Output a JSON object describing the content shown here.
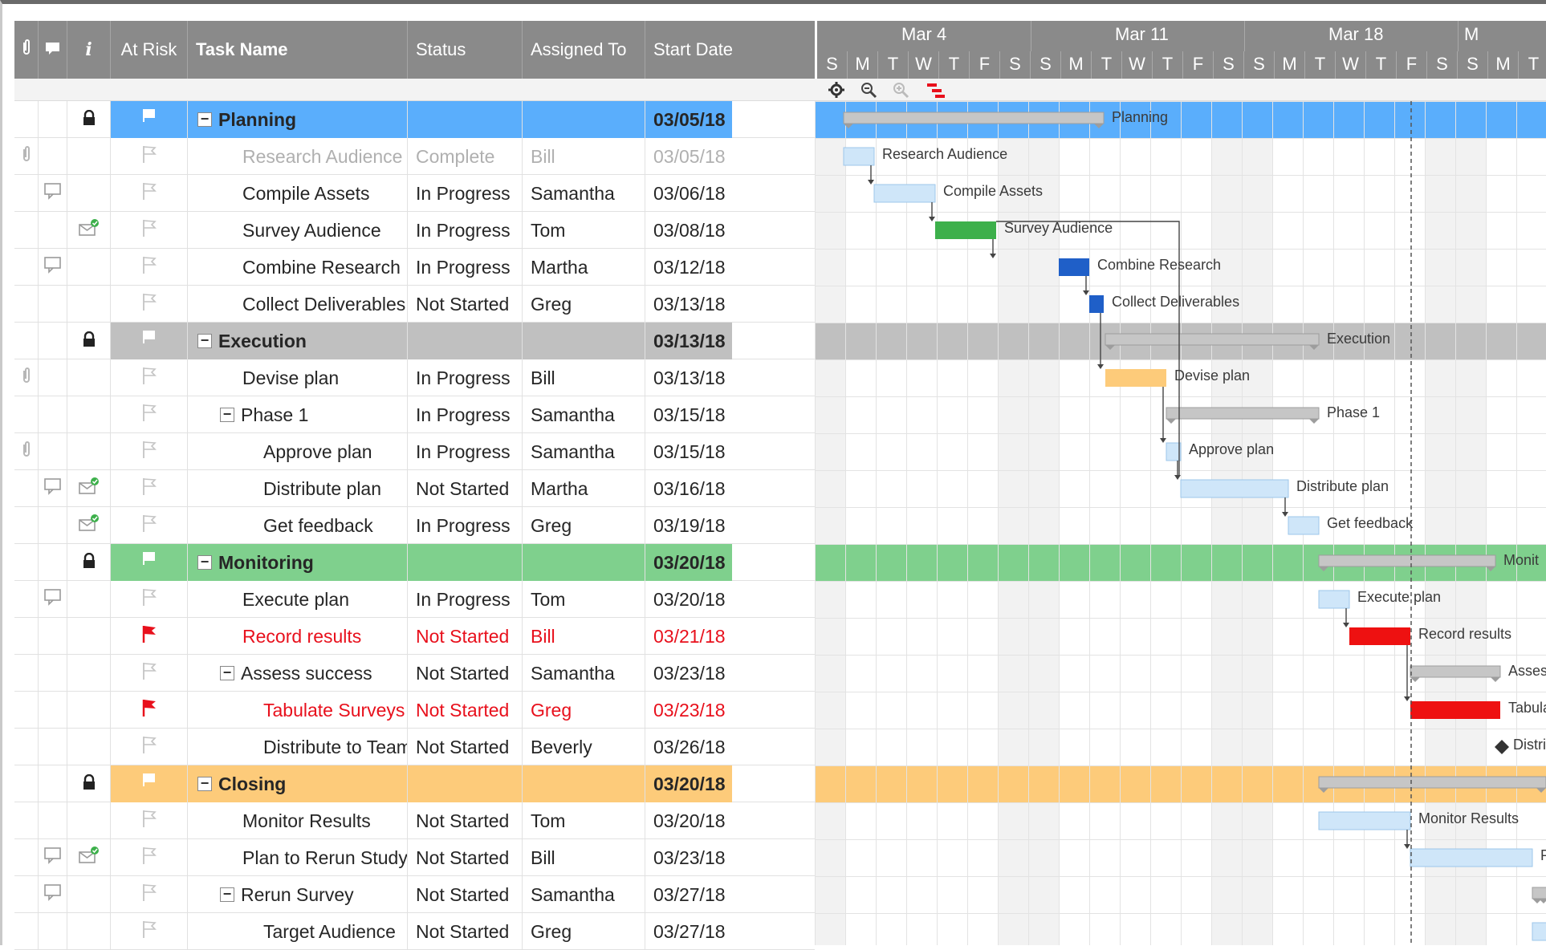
{
  "columns": {
    "attach_icon": "paperclip-icon",
    "comment_icon": "comment-icon",
    "info_icon": "info-icon",
    "at_risk": "At Risk",
    "task_name": "Task Name",
    "status": "Status",
    "assigned_to": "Assigned To",
    "start_date": "Start Date"
  },
  "gantt": {
    "weeks": [
      "Mar 4",
      "Mar 11",
      "Mar 18",
      "M"
    ],
    "days": [
      "S",
      "M",
      "T",
      "W",
      "T",
      "F",
      "S",
      "S",
      "M",
      "T",
      "W",
      "T",
      "F",
      "S",
      "S",
      "M",
      "T",
      "W",
      "T",
      "F",
      "S",
      "S",
      "M",
      "T"
    ],
    "tools": [
      "gear-icon",
      "zoom-out-icon",
      "zoom-in-icon",
      "critical-path-icon"
    ]
  },
  "colors": {
    "planning": "#5aaefc",
    "execution": "#c0c0c0",
    "monitoring": "#7fd08d",
    "closing": "#fdcb7a",
    "risk": "#e8101c",
    "bar_light": "#cfe6f9",
    "bar_green": "#3db04b",
    "bar_blue": "#1f5fc8",
    "bar_orange": "#fdcb7a",
    "bar_red": "#ee1111",
    "bar_gray": "#c6c6c6"
  },
  "rows": [
    {
      "type": "parent",
      "group": "planning",
      "lock": true,
      "name": "Planning",
      "status": "",
      "assigned": "",
      "start": "03/05/18"
    },
    {
      "type": "task",
      "attach": true,
      "name": "Research Audience",
      "status": "Complete",
      "assigned": "Bill",
      "start": "03/05/18",
      "muted": true,
      "indent": 1
    },
    {
      "type": "task",
      "comment": true,
      "name": "Compile Assets",
      "status": "In Progress",
      "assigned": "Samantha",
      "start": "03/06/18",
      "indent": 1
    },
    {
      "type": "task",
      "mail": true,
      "name": "Survey Audience",
      "status": "In Progress",
      "assigned": "Tom",
      "start": "03/08/18",
      "indent": 1
    },
    {
      "type": "task",
      "comment": true,
      "name": "Combine Research",
      "status": "In Progress",
      "assigned": "Martha",
      "start": "03/12/18",
      "indent": 1
    },
    {
      "type": "task",
      "name": "Collect Deliverables",
      "status": "Not Started",
      "assigned": "Greg",
      "start": "03/13/18",
      "indent": 1
    },
    {
      "type": "parent",
      "group": "execution",
      "lock": true,
      "name": "Execution",
      "status": "",
      "assigned": "",
      "start": "03/13/18"
    },
    {
      "type": "task",
      "attach": true,
      "name": "Devise plan",
      "status": "In Progress",
      "assigned": "Bill",
      "start": "03/13/18",
      "indent": 1
    },
    {
      "type": "subparent",
      "name": "Phase 1",
      "status": "In Progress",
      "assigned": "Samantha",
      "start": "03/15/18",
      "indent": 1
    },
    {
      "type": "task",
      "attach": true,
      "name": "Approve plan",
      "status": "In Progress",
      "assigned": "Samantha",
      "start": "03/15/18",
      "indent": 2
    },
    {
      "type": "task",
      "comment": true,
      "mail": true,
      "name": "Distribute plan",
      "status": "Not Started",
      "assigned": "Martha",
      "start": "03/16/18",
      "indent": 2
    },
    {
      "type": "task",
      "mail": true,
      "name": "Get feedback",
      "status": "In Progress",
      "assigned": "Greg",
      "start": "03/19/18",
      "indent": 2
    },
    {
      "type": "parent",
      "group": "monitoring",
      "lock": true,
      "name": "Monitoring",
      "status": "",
      "assigned": "",
      "start": "03/20/18"
    },
    {
      "type": "task",
      "comment": true,
      "name": "Execute plan",
      "status": "In Progress",
      "assigned": "Tom",
      "start": "03/20/18",
      "indent": 1
    },
    {
      "type": "task",
      "risk": true,
      "name": "Record results",
      "status": "Not Started",
      "assigned": "Bill",
      "start": "03/21/18",
      "indent": 1
    },
    {
      "type": "subparent",
      "name": "Assess success",
      "status": "Not Started",
      "assigned": "Samantha",
      "start": "03/23/18",
      "indent": 1
    },
    {
      "type": "task",
      "risk": true,
      "name": "Tabulate Surveys",
      "status": "Not Started",
      "assigned": "Greg",
      "start": "03/23/18",
      "indent": 2
    },
    {
      "type": "task",
      "name": "Distribute to Team",
      "status": "Not Started",
      "assigned": "Beverly",
      "start": "03/26/18",
      "indent": 2
    },
    {
      "type": "parent",
      "group": "closing",
      "lock": true,
      "name": "Closing",
      "status": "",
      "assigned": "",
      "start": "03/20/18"
    },
    {
      "type": "task",
      "name": "Monitor Results",
      "status": "Not Started",
      "assigned": "Tom",
      "start": "03/20/18",
      "indent": 1
    },
    {
      "type": "task",
      "comment": true,
      "mail": true,
      "name": "Plan to Rerun Study",
      "status": "Not Started",
      "assigned": "Bill",
      "start": "03/23/18",
      "indent": 1
    },
    {
      "type": "subparent",
      "comment": true,
      "name": "Rerun Survey",
      "status": "Not Started",
      "assigned": "Samantha",
      "start": "03/27/18",
      "indent": 1
    },
    {
      "type": "task",
      "name": "Target Audience",
      "status": "Not Started",
      "assigned": "Greg",
      "start": "03/27/18",
      "indent": 2
    }
  ],
  "bars": [
    {
      "row": 0,
      "label": "Planning",
      "style": "summary"
    },
    {
      "row": 1,
      "label": "Research Audience",
      "style": "light"
    },
    {
      "row": 2,
      "label": "Compile Assets",
      "style": "light"
    },
    {
      "row": 3,
      "label": "Survey Audience",
      "style": "green"
    },
    {
      "row": 4,
      "label": "Combine Research",
      "style": "blue"
    },
    {
      "row": 5,
      "label": "Collect Deliverables",
      "style": "blue"
    },
    {
      "row": 6,
      "label": "Execution",
      "style": "summary"
    },
    {
      "row": 7,
      "label": "Devise plan",
      "style": "orange"
    },
    {
      "row": 8,
      "label": "Phase 1",
      "style": "summary"
    },
    {
      "row": 9,
      "label": "Approve plan",
      "style": "light"
    },
    {
      "row": 10,
      "label": "Distribute plan",
      "style": "light"
    },
    {
      "row": 11,
      "label": "Get feedback",
      "style": "light"
    },
    {
      "row": 12,
      "label": "Monit",
      "style": "summary"
    },
    {
      "row": 13,
      "label": "Execute plan",
      "style": "light"
    },
    {
      "row": 14,
      "label": "Record results",
      "style": "red"
    },
    {
      "row": 15,
      "label": "Asses",
      "style": "summary"
    },
    {
      "row": 16,
      "label": "Tabula",
      "style": "red"
    },
    {
      "row": 17,
      "label": "Distri",
      "style": "milestone"
    },
    {
      "row": 18,
      "label": "",
      "style": "summary"
    },
    {
      "row": 19,
      "label": "Monitor Results",
      "style": "light"
    },
    {
      "row": 20,
      "label": "P",
      "style": "light"
    },
    {
      "row": 21,
      "label": "",
      "style": "summary"
    },
    {
      "row": 22,
      "label": "",
      "style": "light"
    }
  ]
}
